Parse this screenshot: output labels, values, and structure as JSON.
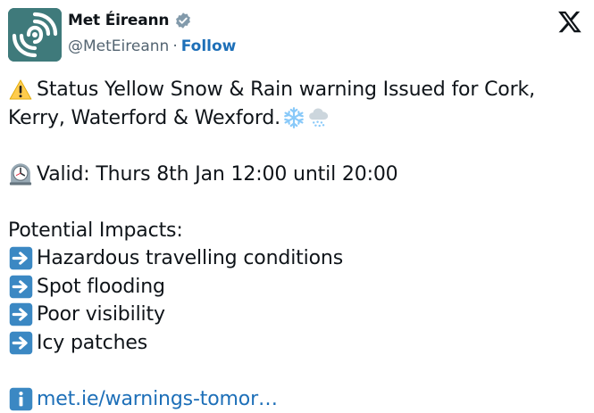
{
  "account": {
    "display_name": "Met Éireann",
    "handle": "@MetEireann",
    "separator": "·",
    "follow_label": "Follow"
  },
  "tweet": {
    "line1": "Status Yellow Snow & Rain warning Issued for Cork,",
    "line2": "Kerry, Waterford & Wexford.",
    "valid": "Valid: Thurs 8th Jan 12:00 until 20:00",
    "impacts_heading": "Potential Impacts:",
    "impacts": [
      "Hazardous travelling conditions",
      "Spot flooding",
      "Poor visibility",
      "Icy patches"
    ],
    "link_text": "met.ie/warnings-tomor…"
  },
  "colors": {
    "avatar_bg": "#3f7a7b",
    "verified": "#829aab",
    "link": "#1d6fb8",
    "arrow_box": "#3b88c3",
    "warning": "#ffcc4d"
  },
  "icons": {
    "warning": "warning-icon",
    "snowflake": "snowflake-icon",
    "cloud_snow": "cloud-with-snow-icon",
    "clock": "mantelpiece-clock-icon",
    "arrow": "right-arrow-icon",
    "info": "information-icon",
    "x_logo": "x-logo-icon",
    "verified": "verified-badge-icon"
  }
}
